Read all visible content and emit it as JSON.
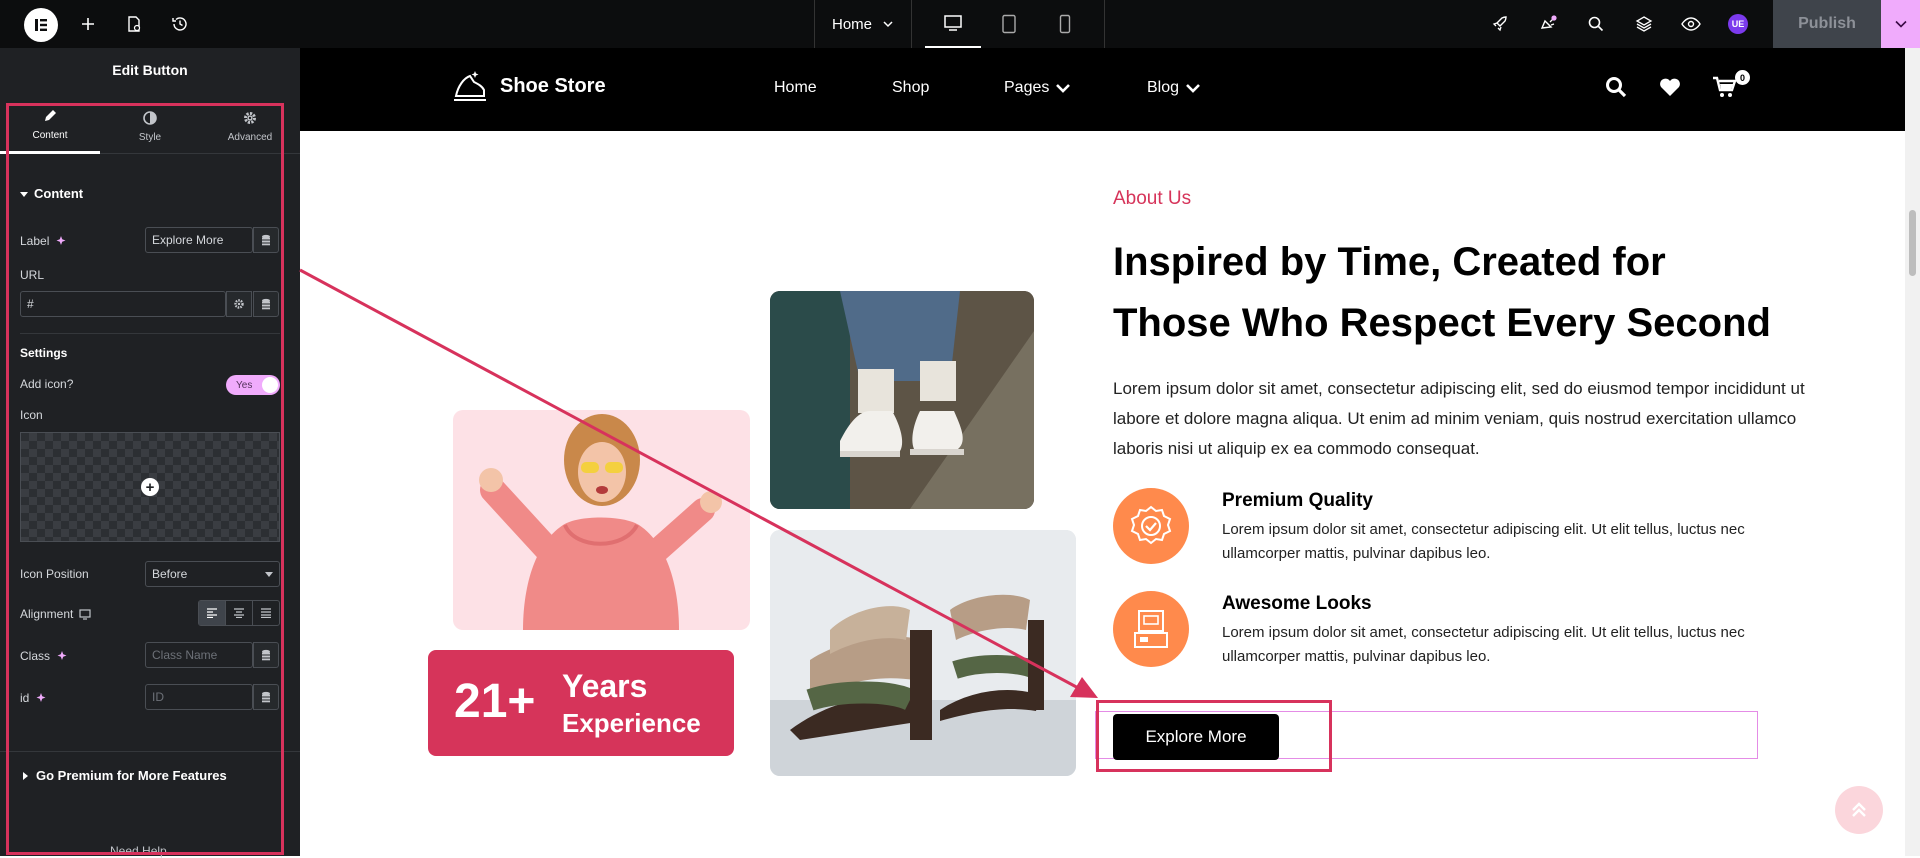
{
  "topbar": {
    "page_name": "Home",
    "publish_label": "Publish",
    "user_initials": "UE",
    "icons": [
      "elementor-logo-icon",
      "add-icon",
      "page-settings-icon",
      "history-icon",
      "desktop-icon",
      "tablet-icon",
      "mobile-icon",
      "rocket-icon",
      "notifications-icon",
      "search-icon",
      "layers-icon",
      "preview-icon"
    ]
  },
  "panel": {
    "title": "Edit Button",
    "tabs": [
      {
        "label": "Content",
        "icon": "pencil-icon"
      },
      {
        "label": "Style",
        "icon": "contrast-icon"
      },
      {
        "label": "Advanced",
        "icon": "gear-icon"
      }
    ],
    "content_section": "Content",
    "label_label": "Label",
    "label_value": "Explore More",
    "url_label": "URL",
    "url_value": "#",
    "settings_label": "Settings",
    "add_icon_label": "Add icon?",
    "add_icon_value": "Yes",
    "icon_label": "Icon",
    "icon_position_label": "Icon Position",
    "icon_position_value": "Before",
    "alignment_label": "Alignment",
    "class_label": "Class",
    "class_placeholder": "Class Name",
    "id_label": "id",
    "id_placeholder": "ID",
    "premium_section": "Go Premium for More Features",
    "need_help": "Need Help"
  },
  "site": {
    "brand": "Shoe Store",
    "menu": [
      {
        "label": "Home",
        "dropdown": false
      },
      {
        "label": "Shop",
        "dropdown": false
      },
      {
        "label": "Pages",
        "dropdown": true
      },
      {
        "label": "Blog",
        "dropdown": true
      }
    ],
    "cart_count": "0",
    "about_label": "About Us",
    "heading_line1": "Inspired by Time, Created for",
    "heading_line2": "Those Who Respect Every Second",
    "paragraph": "Lorem ipsum dolor sit amet, consectetur adipiscing elit, sed do eiusmod tempor incididunt ut labore et dolore magna aliqua. Ut enim ad minim veniam, quis nostrud exercitation ullamco laboris nisi ut aliquip ex ea commodo consequat.",
    "features": [
      {
        "title": "Premium Quality",
        "text": "Lorem ipsum dolor sit amet, consectetur adipiscing elit. Ut elit tellus, luctus nec ullamcorper mattis, pulvinar dapibus leo.",
        "icon": "badge-check-icon"
      },
      {
        "title": "Awesome Looks",
        "text": "Lorem ipsum dolor sit amet, consectetur adipiscing elit. Ut elit tellus, luctus nec ullamcorper mattis, pulvinar dapibus leo.",
        "icon": "cash-register-icon"
      }
    ],
    "years_num": "21+",
    "years_word": "Years",
    "years_sub": "Experience",
    "button_label": "Explore More"
  },
  "colors": {
    "accent": "#d6345a",
    "orange": "#ff8a4c",
    "pink": "#f0abfc",
    "panel_bg": "#1f2124"
  }
}
